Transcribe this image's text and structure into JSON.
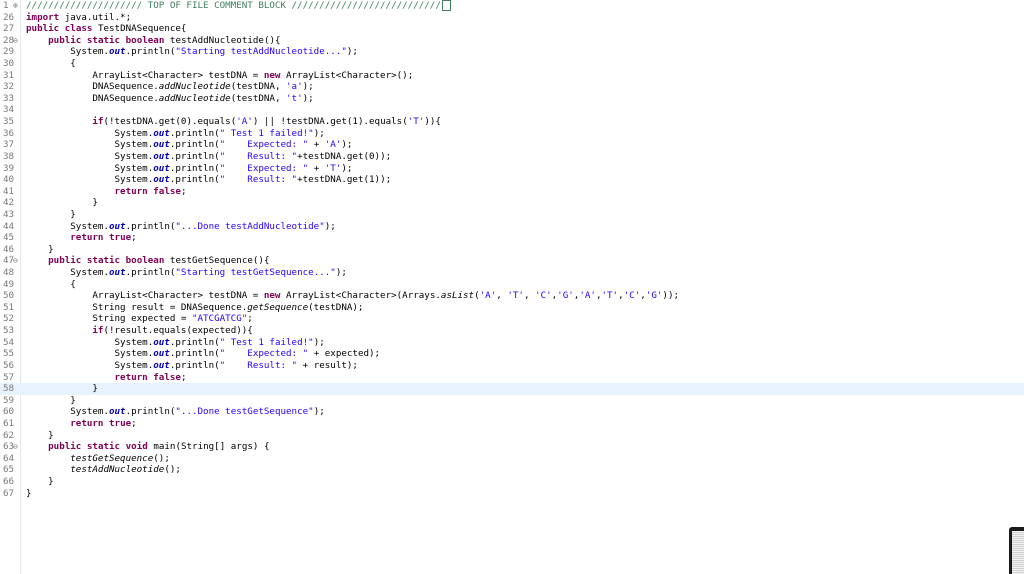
{
  "editor": {
    "header_comment": "///////////////////// TOP OF FILE COMMENT BLOCK ///////////////////////////",
    "current_line": "58",
    "lines": [
      {
        "n": "1",
        "fold": "+"
      },
      {
        "n": "26"
      },
      {
        "n": "27"
      },
      {
        "n": "28",
        "fold": "−"
      },
      {
        "n": "29"
      },
      {
        "n": "30"
      },
      {
        "n": "31"
      },
      {
        "n": "32"
      },
      {
        "n": "33"
      },
      {
        "n": "34"
      },
      {
        "n": "35"
      },
      {
        "n": "36"
      },
      {
        "n": "37"
      },
      {
        "n": "38"
      },
      {
        "n": "39"
      },
      {
        "n": "40"
      },
      {
        "n": "41"
      },
      {
        "n": "42"
      },
      {
        "n": "43"
      },
      {
        "n": "44"
      },
      {
        "n": "45"
      },
      {
        "n": "46"
      },
      {
        "n": "47",
        "fold": "−"
      },
      {
        "n": "48"
      },
      {
        "n": "49"
      },
      {
        "n": "50"
      },
      {
        "n": "51"
      },
      {
        "n": "52"
      },
      {
        "n": "53"
      },
      {
        "n": "54"
      },
      {
        "n": "55"
      },
      {
        "n": "56"
      },
      {
        "n": "57"
      },
      {
        "n": "58"
      },
      {
        "n": "59"
      },
      {
        "n": "60"
      },
      {
        "n": "61"
      },
      {
        "n": "62"
      },
      {
        "n": "63",
        "fold": "−"
      },
      {
        "n": "64"
      },
      {
        "n": "65"
      },
      {
        "n": "66"
      },
      {
        "n": "67"
      }
    ],
    "tokens": {
      "l26": [
        "import",
        " java.util.*;"
      ],
      "l27": [
        "public",
        " ",
        "class",
        " TestDNASequence{"
      ],
      "l28": [
        "    ",
        "public",
        " ",
        "static",
        " ",
        "boolean",
        " testAddNucleotide(){"
      ],
      "l29": [
        "        System.",
        "out",
        ".println(",
        "\"Starting testAddNucleotide...\"",
        ");"
      ],
      "l30": [
        "        {"
      ],
      "l31": [
        "            ArrayList<Character> testDNA = ",
        "new",
        " ArrayList<Character>();"
      ],
      "l32": [
        "            DNASequence.",
        "addNucleotide",
        "(testDNA, ",
        "'a'",
        ");"
      ],
      "l33": [
        "            DNASequence.",
        "addNucleotide",
        "(testDNA, ",
        "'t'",
        ");"
      ],
      "l34": [
        ""
      ],
      "l35": [
        "            ",
        "if",
        "(!testDNA.get(0).equals(",
        "'A'",
        ") || !testDNA.get(1).equals(",
        "'T'",
        ")){"
      ],
      "l36": [
        "                System.",
        "out",
        ".println(",
        "\" Test 1 failed!\"",
        ");"
      ],
      "l37": [
        "                System.",
        "out",
        ".println(",
        "\"    Expected: \"",
        " + ",
        "'A'",
        ");"
      ],
      "l38": [
        "                System.",
        "out",
        ".println(",
        "\"    Result: \"",
        "+testDNA.get(0));"
      ],
      "l39": [
        "                System.",
        "out",
        ".println(",
        "\"    Expected: \"",
        " + ",
        "'T'",
        ");"
      ],
      "l40": [
        "                System.",
        "out",
        ".println(",
        "\"    Result: \"",
        "+testDNA.get(1));"
      ],
      "l41": [
        "                ",
        "return",
        " ",
        "false",
        ";"
      ],
      "l42": [
        "            }"
      ],
      "l43": [
        "        }"
      ],
      "l44": [
        "        System.",
        "out",
        ".println(",
        "\"...Done testAddNucleotide\"",
        ");"
      ],
      "l45": [
        "        ",
        "return",
        " ",
        "true",
        ";"
      ],
      "l46": [
        "    }"
      ],
      "l47": [
        "    ",
        "public",
        " ",
        "static",
        " ",
        "boolean",
        " testGetSequence(){"
      ],
      "l48": [
        "        System.",
        "out",
        ".println(",
        "\"Starting testGetSequence...\"",
        ");"
      ],
      "l49": [
        "        {"
      ],
      "l50": [
        "            ArrayList<Character> testDNA = ",
        "new",
        " ArrayList<Character>(Arrays.",
        "asList",
        "(",
        "'A'",
        ", ",
        "'T'",
        ", ",
        "'C'",
        ",",
        "'G'",
        ",",
        "'A'",
        ",",
        "'T'",
        ",",
        "'C'",
        ",",
        "'G'",
        "));"
      ],
      "l51": [
        "            String result = DNASequence.",
        "getSequence",
        "(testDNA);"
      ],
      "l52": [
        "            String expected = ",
        "\"ATCGATCG\"",
        ";"
      ],
      "l53": [
        "            ",
        "if",
        "(!result.equals(expected)){"
      ],
      "l54": [
        "                System.",
        "out",
        ".println(",
        "\" Test 1 failed!\"",
        ");"
      ],
      "l55": [
        "                System.",
        "out",
        ".println(",
        "\"    Expected: \"",
        " + expected);"
      ],
      "l56": [
        "                System.",
        "out",
        ".println(",
        "\"    Result: \"",
        " + result);"
      ],
      "l57": [
        "                ",
        "return",
        " ",
        "false",
        ";"
      ],
      "l58": [
        "            }"
      ],
      "l59": [
        "        }"
      ],
      "l60": [
        "        System.",
        "out",
        ".println(",
        "\"...Done testGetSequence\"",
        ");"
      ],
      "l61": [
        "        ",
        "return",
        " ",
        "true",
        ";"
      ],
      "l62": [
        "    }"
      ],
      "l63": [
        "    ",
        "public",
        " ",
        "static",
        " ",
        "void",
        " main(String[] args) {"
      ],
      "l64": [
        "        ",
        "testGetSequence",
        "();"
      ],
      "l65": [
        "        ",
        "testAddNucleotide",
        "();"
      ],
      "l66": [
        "    }"
      ],
      "l67": [
        "}"
      ]
    }
  }
}
